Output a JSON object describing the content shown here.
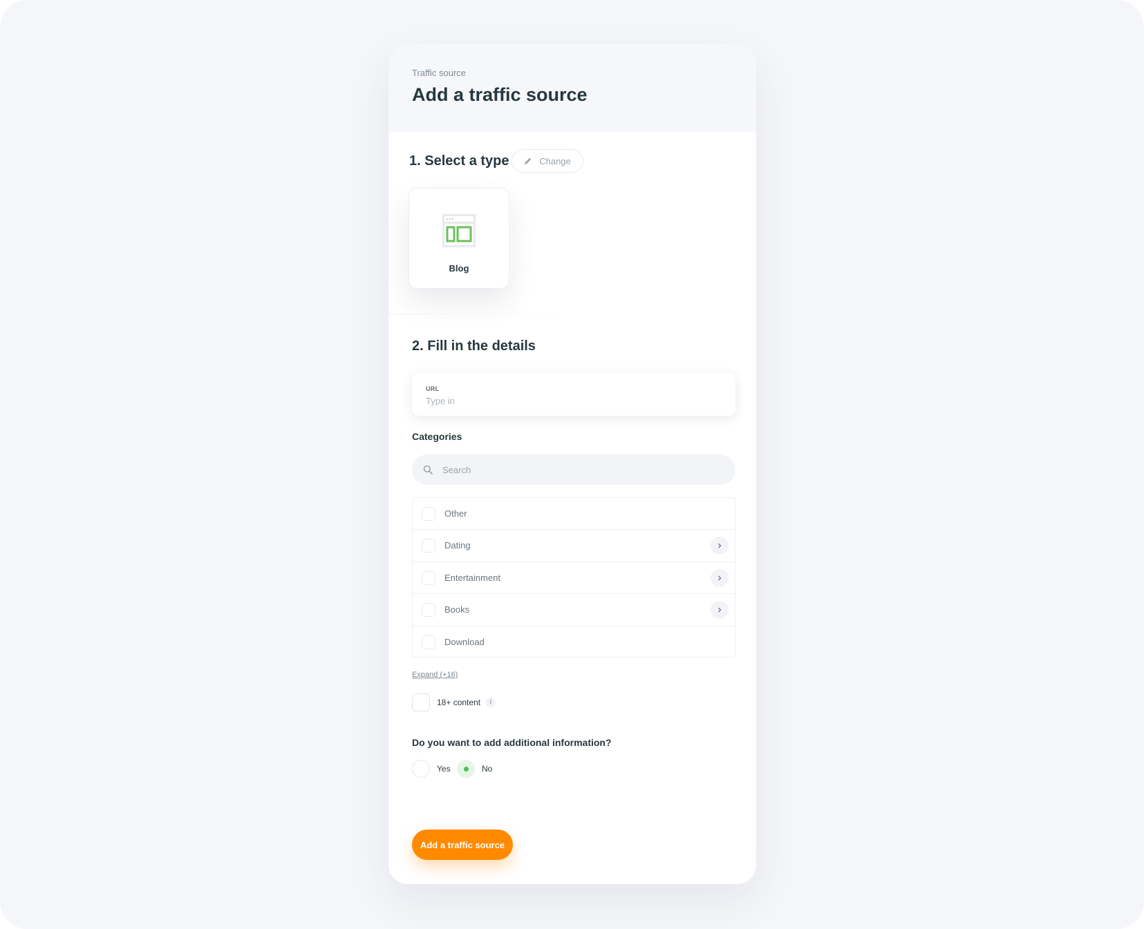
{
  "header": {
    "breadcrumb": "Traffic source",
    "title": "Add a traffic source"
  },
  "step1": {
    "title": "1. Select a type",
    "change_label": "Change",
    "selected_type": {
      "label": "Blog",
      "icon": "blog-layout-icon"
    }
  },
  "step2": {
    "title": "2. Fill in the details",
    "url": {
      "label": "URL",
      "placeholder": "Type in",
      "value": ""
    }
  },
  "categories": {
    "title": "Categories",
    "search_placeholder": "Search",
    "items": [
      {
        "label": "Other",
        "has_children": false,
        "checked": false
      },
      {
        "label": "Dating",
        "has_children": true,
        "checked": false
      },
      {
        "label": "Entertainment",
        "has_children": true,
        "checked": false
      },
      {
        "label": "Books",
        "has_children": true,
        "checked": false
      },
      {
        "label": "Download",
        "has_children": false,
        "checked": false
      }
    ],
    "expand_label": "Expand (+16)"
  },
  "adult": {
    "label": "18+ content",
    "info": "i",
    "checked": false
  },
  "additional": {
    "question": "Do you want to add additional information?",
    "options": [
      {
        "label": "Yes",
        "selected": false
      },
      {
        "label": "No",
        "selected": true
      }
    ]
  },
  "submit_label": "Add a traffic source",
  "colors": {
    "accent": "#ff8a00",
    "success": "#4ebf56",
    "icon_green": "#6bbf5c",
    "background": "#f5f6fa",
    "title_text": "#263840"
  }
}
